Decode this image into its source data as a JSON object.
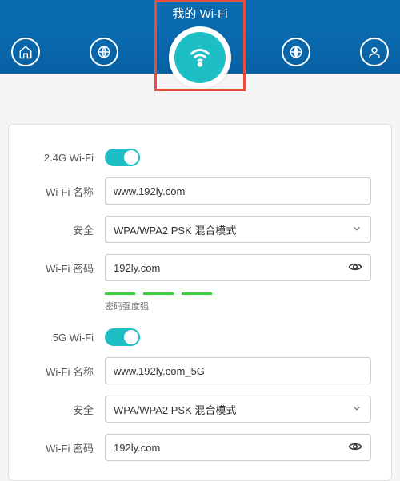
{
  "header": {
    "title": "我的 Wi-Fi"
  },
  "wifi24": {
    "toggle_label": "2.4G Wi-Fi",
    "name_label": "Wi-Fi 名称",
    "name_value": "www.192ly.com",
    "security_label": "安全",
    "security_value": "WPA/WPA2 PSK 混合模式",
    "password_label": "Wi-Fi 密码",
    "password_value": "192ly.com",
    "strength_text": "密码强度强"
  },
  "wifi5": {
    "toggle_label": "5G Wi-Fi",
    "name_label": "Wi-Fi 名称",
    "name_value": "www.192ly.com_5G",
    "security_label": "安全",
    "security_value": "WPA/WPA2 PSK 混合模式",
    "password_label": "Wi-Fi 密码",
    "password_value": "192ly.com"
  }
}
